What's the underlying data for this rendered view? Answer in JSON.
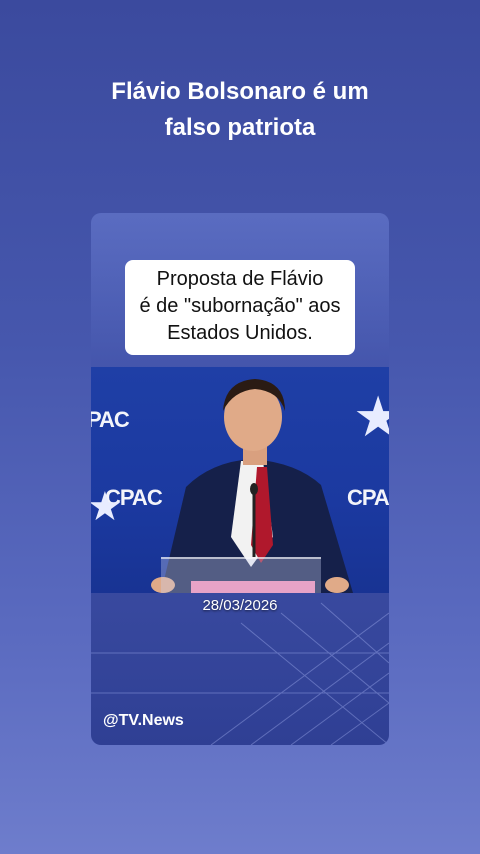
{
  "headline": {
    "line1": "Flávio Bolsonaro é um",
    "line2": "falso patriota"
  },
  "card": {
    "caption": {
      "line1": "Proposta de Flávio",
      "line2": "é de \"subornação\" aos",
      "line3": "Estados Unidos."
    },
    "video": {
      "brand_text": "CPAC",
      "brand_text_partial": "PAC"
    },
    "date": "28/03/2026",
    "handle": "@TV.News"
  },
  "colors": {
    "background_top": "#3b4a9e",
    "background_bottom": "#6e7dcc",
    "stage_blue": "#1f3fa6",
    "tie_red": "#b0182c",
    "caption_bg": "#ffffff"
  }
}
